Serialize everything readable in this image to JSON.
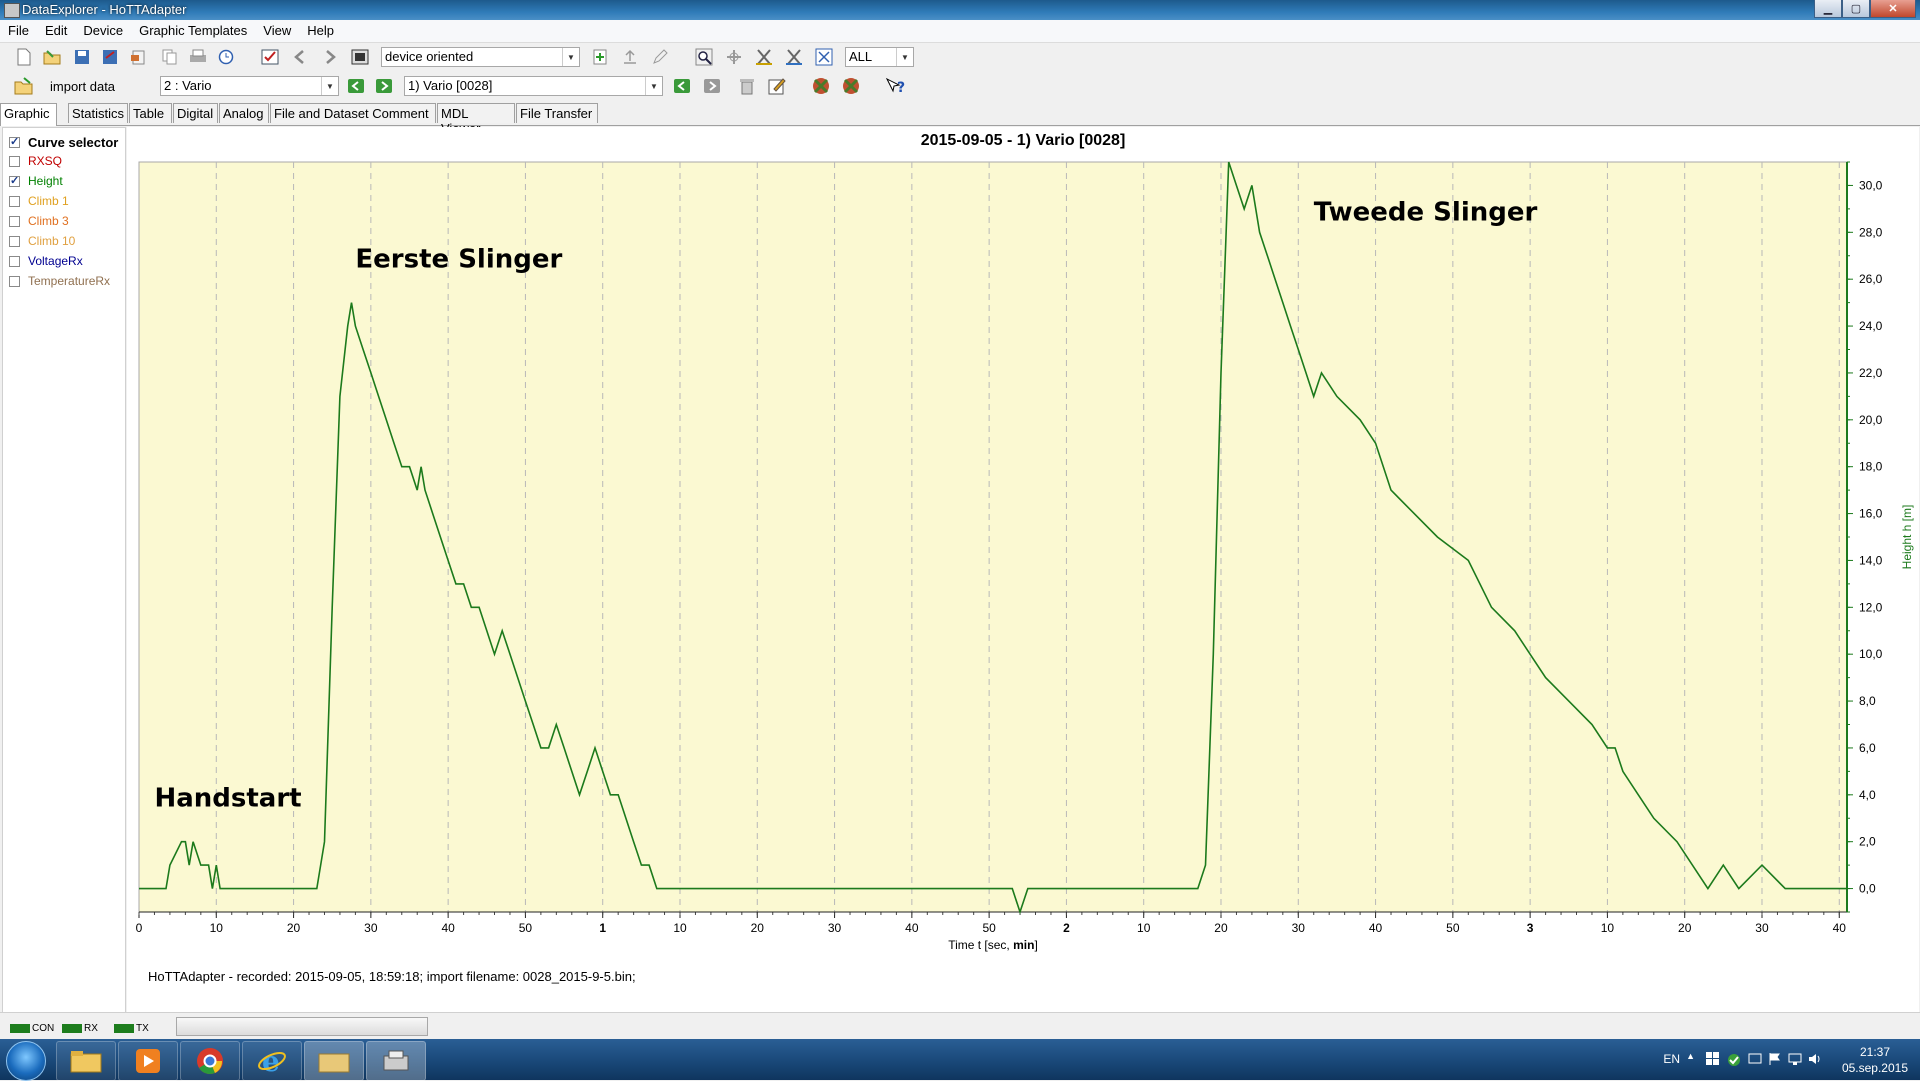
{
  "window": {
    "title": "DataExplorer - HoTTAdapter"
  },
  "menu": [
    "File",
    "Edit",
    "Device",
    "Graphic Templates",
    "View",
    "Help"
  ],
  "toolbar": {
    "device_mode": "device oriented",
    "scope": "ALL",
    "import_label": "import data",
    "channel": "2 : Vario",
    "record": "1) Vario [0028]"
  },
  "tabs": [
    "Graphic",
    "Statistics",
    "Table",
    "Digital",
    "Analog",
    "File and Dataset Comment",
    "MDL Viewer",
    "File Transfer"
  ],
  "active_tab": "Graphic",
  "curve_selector": {
    "header": "Curve selector",
    "items": [
      {
        "label": "RXSQ",
        "checked": false,
        "color": "#c00000"
      },
      {
        "label": "Height",
        "checked": true,
        "color": "#008000"
      },
      {
        "label": "Climb 1",
        "checked": false,
        "color": "#e0a020"
      },
      {
        "label": "Climb 3",
        "checked": false,
        "color": "#e07020"
      },
      {
        "label": "Climb 10",
        "checked": false,
        "color": "#e0a040"
      },
      {
        "label": "VoltageRx",
        "checked": false,
        "color": "#000090"
      },
      {
        "label": "TemperatureRx",
        "checked": false,
        "color": "#907050"
      }
    ]
  },
  "chart_data": {
    "type": "line",
    "title": "2015-09-05 - 1) Vario [0028]",
    "xlabel_prefix": "Time   t   [sec, ",
    "xlabel_bold": "min",
    "xlabel_suffix": "]",
    "ylabel": "Height   h   [m]",
    "xlim_seconds": [
      0,
      221
    ],
    "ylim": [
      -1,
      31
    ],
    "x_ticks": [
      "0",
      "10",
      "20",
      "30",
      "40",
      "50",
      "1",
      "10",
      "20",
      "30",
      "40",
      "50",
      "2",
      "10",
      "20",
      "30",
      "40",
      "50",
      "3",
      "10",
      "20",
      "30",
      "40"
    ],
    "y_ticks": [
      "0,0",
      "2,0",
      "4,0",
      "6,0",
      "8,0",
      "10,0",
      "12,0",
      "14,0",
      "16,0",
      "18,0",
      "20,0",
      "22,0",
      "24,0",
      "26,0",
      "28,0",
      "30,0"
    ],
    "annotations": [
      {
        "text": "Handstart",
        "x": 2,
        "y": 3.5
      },
      {
        "text": "Eerste Slinger",
        "x": 28,
        "y": 26.5
      },
      {
        "text": "Tweede Slinger",
        "x": 152,
        "y": 28.5
      }
    ],
    "series": [
      {
        "color": "#1c7a1c",
        "x_seconds": [
          0,
          3.5,
          4,
          5.5,
          6,
          6.5,
          7,
          8,
          9,
          9.5,
          10,
          10.5,
          11,
          12,
          23,
          24,
          25,
          26,
          27,
          27.5,
          28,
          29,
          30,
          31,
          32,
          33,
          34,
          35,
          36,
          36.5,
          37,
          38,
          39,
          40,
          41,
          42,
          43,
          44,
          45,
          46,
          47,
          48,
          49,
          50,
          51,
          52,
          53,
          54,
          55,
          56,
          57,
          58,
          59,
          60,
          61,
          62,
          63,
          64,
          65,
          66,
          67,
          70,
          113,
          114,
          115,
          137,
          138,
          139,
          140,
          141,
          142,
          143,
          144,
          145,
          146,
          147,
          148,
          149,
          150,
          151,
          152,
          153,
          155,
          158,
          160,
          162,
          165,
          168,
          172,
          175,
          178,
          180,
          182,
          185,
          188,
          190,
          191,
          192,
          194,
          196,
          199,
          201,
          203,
          205,
          207,
          210,
          213,
          215,
          221
        ],
        "y": [
          0,
          0,
          1,
          2,
          2,
          1,
          2,
          1,
          1,
          0,
          1,
          0,
          0,
          0,
          0,
          2,
          12,
          21,
          24,
          25,
          24,
          23,
          22,
          21,
          20,
          19,
          18,
          18,
          17,
          18,
          17,
          16,
          15,
          14,
          13,
          13,
          12,
          12,
          11,
          10,
          11,
          10,
          9,
          8,
          7,
          6,
          6,
          7,
          6,
          5,
          4,
          5,
          6,
          5,
          4,
          4,
          3,
          2,
          1,
          1,
          0,
          0,
          0,
          -1,
          0,
          0,
          1,
          10,
          22,
          31,
          30,
          29,
          30,
          28,
          27,
          26,
          25,
          24,
          23,
          22,
          21,
          22,
          21,
          20,
          19,
          17,
          16,
          15,
          14,
          12,
          11,
          10,
          9,
          8,
          7,
          6,
          6,
          5,
          4,
          3,
          2,
          1,
          0,
          1,
          0,
          1,
          0,
          0,
          0
        ]
      }
    ]
  },
  "footer_text": "HoTTAdapter - recorded: 2015-09-05, 18:59:18; import filename: 0028_2015-9-5.bin;",
  "status_leds": [
    "CON",
    "RX",
    "TX"
  ],
  "tray": {
    "language": "EN",
    "time": "21:37",
    "date": "05.sep.2015"
  }
}
